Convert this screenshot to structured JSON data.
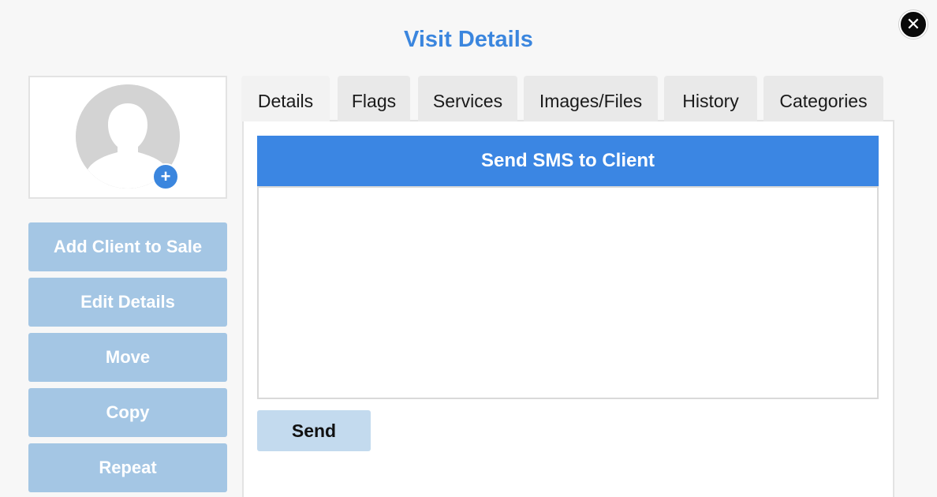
{
  "modal": {
    "title": "Visit Details",
    "close_icon": "close-icon"
  },
  "profile": {
    "avatar_icon": "user-silhouette-icon",
    "add_photo_icon": "plus-icon",
    "add_photo_symbol": "+"
  },
  "actions": [
    {
      "label": "Add Client to Sale"
    },
    {
      "label": "Edit Details"
    },
    {
      "label": "Move"
    },
    {
      "label": "Copy"
    },
    {
      "label": "Repeat"
    }
  ],
  "tabs": [
    {
      "label": "Details",
      "active": true
    },
    {
      "label": "Flags"
    },
    {
      "label": "Services"
    },
    {
      "label": "Images/Files"
    },
    {
      "label": "History"
    },
    {
      "label": "Categories"
    }
  ],
  "sms": {
    "header": "Send SMS to Client",
    "message": "",
    "send_label": "Send"
  },
  "colors": {
    "accent": "#3b86de",
    "action_button": "#a4c6e4",
    "send_button": "#c3daee"
  }
}
